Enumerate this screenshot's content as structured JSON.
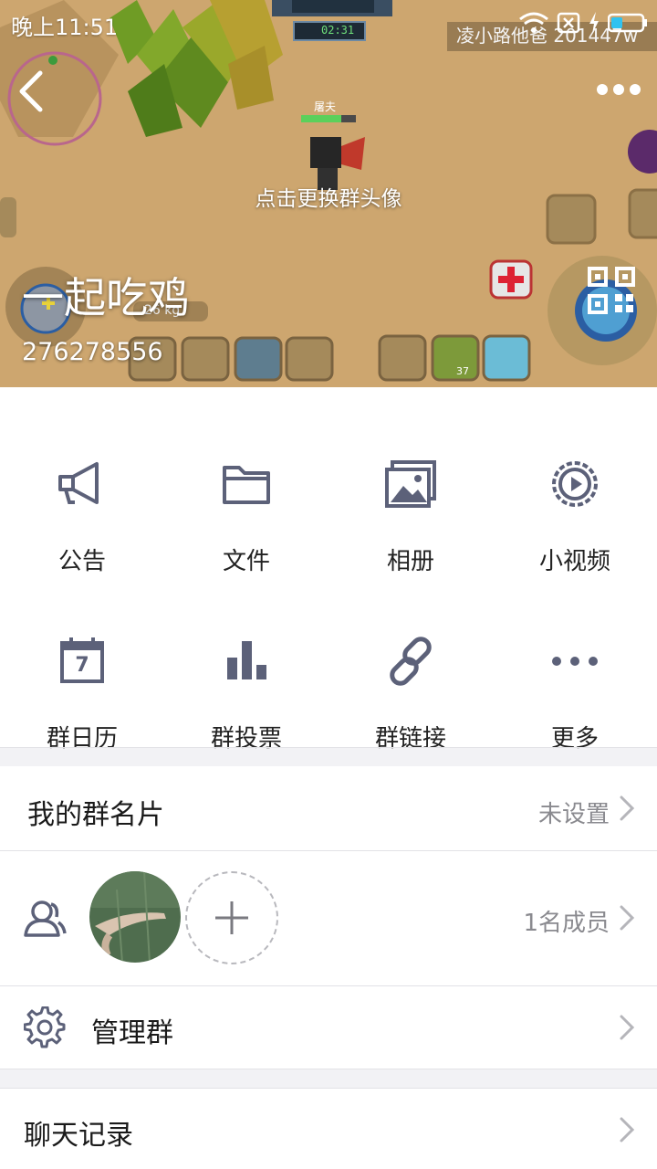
{
  "status_bar": {
    "time": "晚上11:51",
    "watermark": "凌小路他爸  201447w"
  },
  "header": {
    "game": {
      "player_name": "屠夫",
      "timer": "02:31",
      "weight": "26 kg",
      "ammo": "37"
    },
    "change_avatar_label": "点击更换群头像",
    "group_name": "一起吃鸡",
    "group_id": "276278556"
  },
  "features": [
    {
      "label": "公告",
      "icon": "megaphone-icon"
    },
    {
      "label": "文件",
      "icon": "folder-icon"
    },
    {
      "label": "相册",
      "icon": "album-icon"
    },
    {
      "label": "小视频",
      "icon": "video-icon"
    },
    {
      "label": "群日历",
      "icon": "calendar-icon",
      "day": "7"
    },
    {
      "label": "群投票",
      "icon": "vote-icon"
    },
    {
      "label": "群链接",
      "icon": "link-icon"
    },
    {
      "label": "更多",
      "icon": "more-icon"
    }
  ],
  "card_row": {
    "title": "我的群名片",
    "value": "未设置"
  },
  "members_row": {
    "count": "1名成员"
  },
  "manage_row": {
    "title": "管理群"
  },
  "history_row": {
    "title": "聊天记录"
  },
  "colors": {
    "icon": "#5c6179",
    "text": "#1a1a1a",
    "hint": "#8a8a8f",
    "divider": "#e2e2e6",
    "page_bg": "#f2f2f5"
  }
}
